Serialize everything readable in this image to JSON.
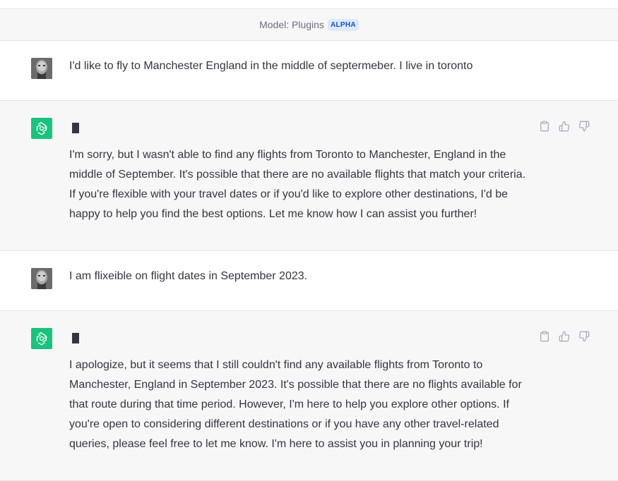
{
  "header": {
    "model_label": "Model: Plugins",
    "badge": "ALPHA"
  },
  "conversation": [
    {
      "role": "user",
      "text": "I'd like to fly to Manchester England in the middle of septermeber. I live in toronto"
    },
    {
      "role": "assistant",
      "text": "I'm sorry, but I wasn't able to find any flights from Toronto to Manchester, England in the middle of September. It's possible that there are no available flights that match your criteria. If you're flexible with your travel dates or if you'd like to explore other destinations, I'd be happy to help you find the best options. Let me know how I can assist you further!"
    },
    {
      "role": "user",
      "text": "I am flixeible on flight dates in September 2023."
    },
    {
      "role": "assistant",
      "text": "I apologize, but it seems that I still couldn't find any available flights from Toronto to Manchester, England in September 2023. It's possible that there are no flights available for that route during that time period. However, I'm here to help you explore other options. If you're open to considering different destinations or if you have any other travel-related queries, please feel free to let me know. I'm here to assist you in planning your trip!"
    }
  ],
  "icons": {
    "copy": "clipboard-icon",
    "like": "thumbs-up-icon",
    "dislike": "thumbs-down-icon",
    "assistant_avatar": "openai-logo-icon",
    "user_avatar": "user-photo-avatar"
  },
  "colors": {
    "assistant_bg": "#f7f7f8",
    "user_bg": "#ffffff",
    "gpt_green": "#19c37d",
    "badge_bg": "#dbeafe",
    "badge_text": "#1d4ed8",
    "text": "#343541"
  }
}
